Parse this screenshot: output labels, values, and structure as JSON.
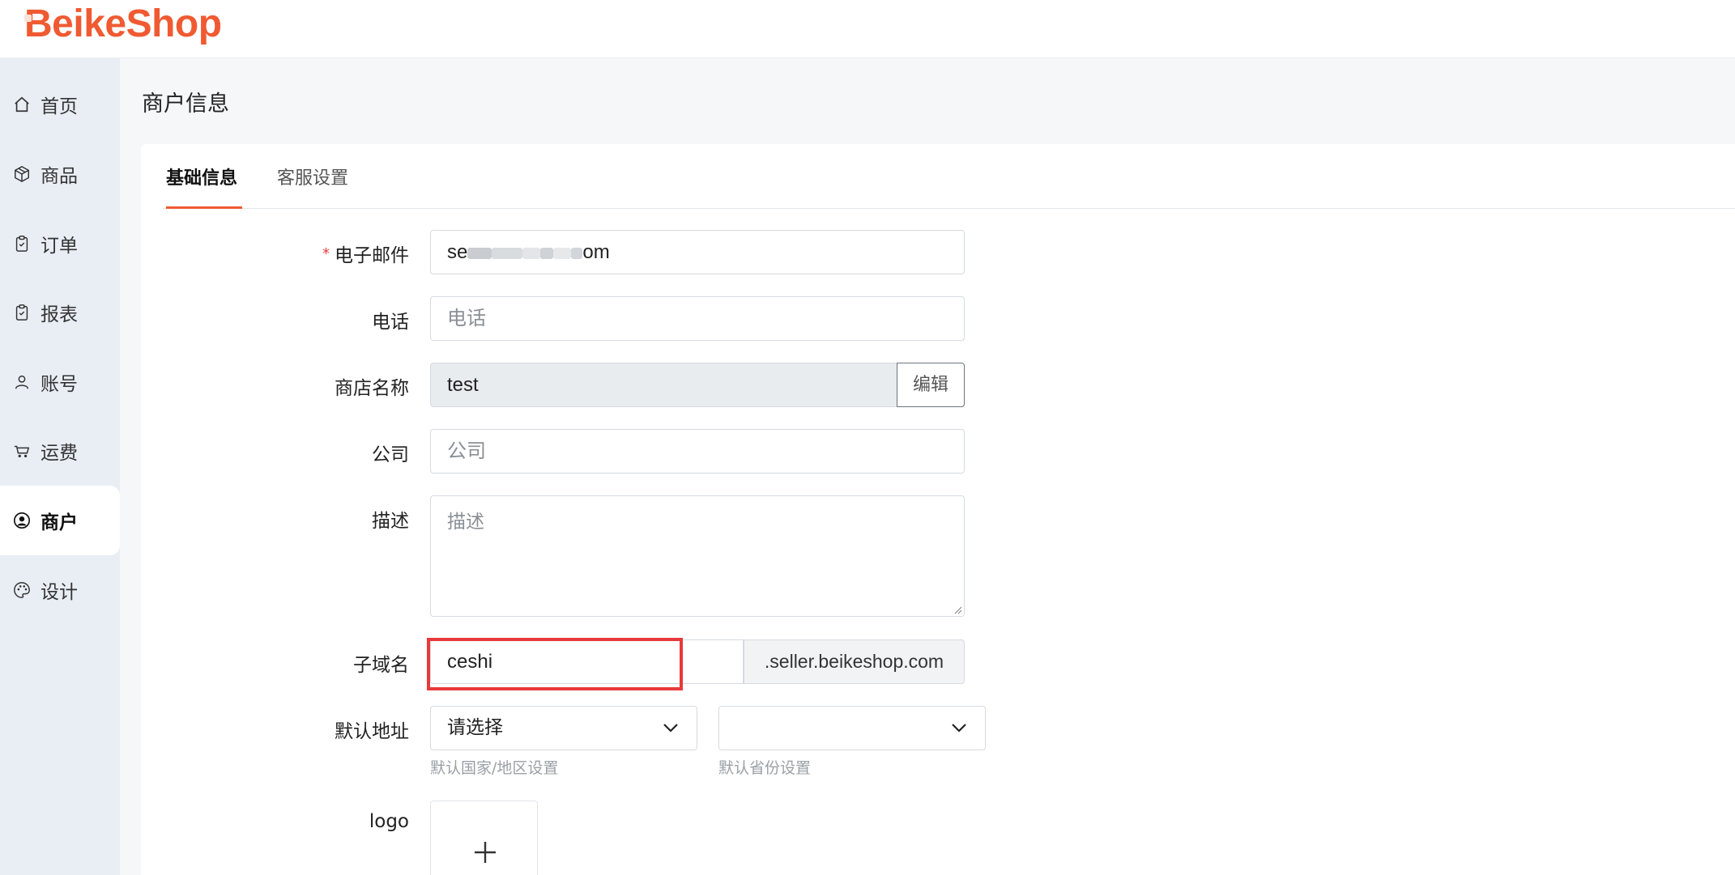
{
  "app": {
    "logo": "BeikeShop"
  },
  "sidebar": {
    "items": [
      {
        "label": "首页",
        "icon": "home-icon"
      },
      {
        "label": "商品",
        "icon": "box-icon"
      },
      {
        "label": "订单",
        "icon": "clipboard-icon"
      },
      {
        "label": "报表",
        "icon": "clipboard-check-icon"
      },
      {
        "label": "账号",
        "icon": "user-icon"
      },
      {
        "label": "运费",
        "icon": "cart-icon"
      },
      {
        "label": "商户",
        "icon": "user-circle-icon",
        "active": true
      },
      {
        "label": "设计",
        "icon": "palette-icon"
      }
    ]
  },
  "page": {
    "title": "商户信息"
  },
  "tabs": [
    {
      "label": "基础信息",
      "active": true
    },
    {
      "label": "客服设置",
      "active": false
    }
  ],
  "form": {
    "email": {
      "label": "电子邮件",
      "required_mark": "*",
      "value_start": "se",
      "value_end": "om"
    },
    "phone": {
      "label": "电话",
      "placeholder": "电话"
    },
    "shop_name": {
      "label": "商店名称",
      "value": "test",
      "edit_button": "编辑"
    },
    "company": {
      "label": "公司",
      "placeholder": "公司"
    },
    "description": {
      "label": "描述",
      "placeholder": "描述"
    },
    "subdomain": {
      "label": "子域名",
      "value": "ceshi",
      "suffix": ".seller.beikeshop.com"
    },
    "default_address": {
      "label": "默认地址",
      "country_value": "请选择",
      "country_help": "默认国家/地区设置",
      "province_value": "",
      "province_help": "默认省份设置"
    },
    "logo": {
      "label": "logo"
    }
  },
  "colors": {
    "brand": "#f05a32",
    "highlight": "#e8393b",
    "required": "#e03c3c"
  }
}
